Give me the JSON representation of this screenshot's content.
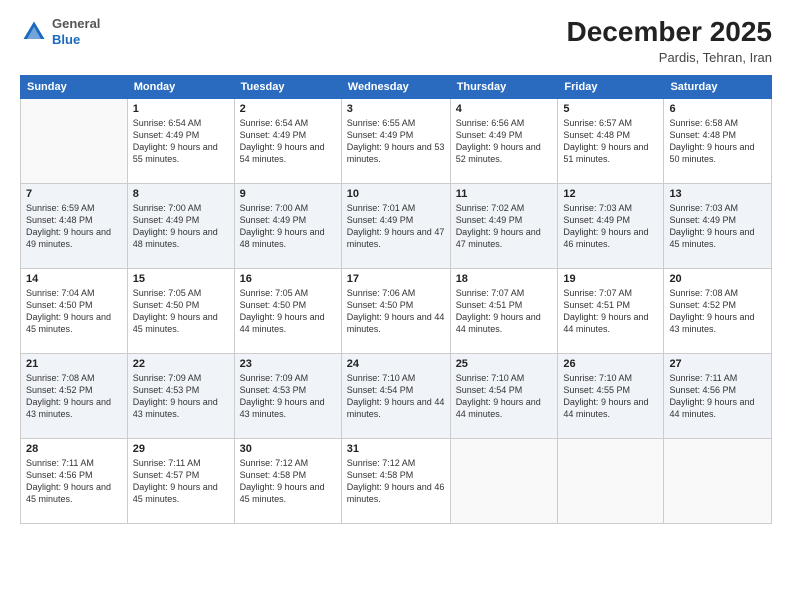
{
  "header": {
    "logo_general": "General",
    "logo_blue": "Blue",
    "month_title": "December 2025",
    "location": "Pardis, Tehran, Iran"
  },
  "columns": [
    "Sunday",
    "Monday",
    "Tuesday",
    "Wednesday",
    "Thursday",
    "Friday",
    "Saturday"
  ],
  "weeks": [
    {
      "shaded": false,
      "days": [
        {
          "num": "",
          "info": ""
        },
        {
          "num": "1",
          "info": "Sunrise: 6:54 AM\nSunset: 4:49 PM\nDaylight: 9 hours\nand 55 minutes."
        },
        {
          "num": "2",
          "info": "Sunrise: 6:54 AM\nSunset: 4:49 PM\nDaylight: 9 hours\nand 54 minutes."
        },
        {
          "num": "3",
          "info": "Sunrise: 6:55 AM\nSunset: 4:49 PM\nDaylight: 9 hours\nand 53 minutes."
        },
        {
          "num": "4",
          "info": "Sunrise: 6:56 AM\nSunset: 4:49 PM\nDaylight: 9 hours\nand 52 minutes."
        },
        {
          "num": "5",
          "info": "Sunrise: 6:57 AM\nSunset: 4:48 PM\nDaylight: 9 hours\nand 51 minutes."
        },
        {
          "num": "6",
          "info": "Sunrise: 6:58 AM\nSunset: 4:48 PM\nDaylight: 9 hours\nand 50 minutes."
        }
      ]
    },
    {
      "shaded": true,
      "days": [
        {
          "num": "7",
          "info": "Sunrise: 6:59 AM\nSunset: 4:48 PM\nDaylight: 9 hours\nand 49 minutes."
        },
        {
          "num": "8",
          "info": "Sunrise: 7:00 AM\nSunset: 4:49 PM\nDaylight: 9 hours\nand 48 minutes."
        },
        {
          "num": "9",
          "info": "Sunrise: 7:00 AM\nSunset: 4:49 PM\nDaylight: 9 hours\nand 48 minutes."
        },
        {
          "num": "10",
          "info": "Sunrise: 7:01 AM\nSunset: 4:49 PM\nDaylight: 9 hours\nand 47 minutes."
        },
        {
          "num": "11",
          "info": "Sunrise: 7:02 AM\nSunset: 4:49 PM\nDaylight: 9 hours\nand 47 minutes."
        },
        {
          "num": "12",
          "info": "Sunrise: 7:03 AM\nSunset: 4:49 PM\nDaylight: 9 hours\nand 46 minutes."
        },
        {
          "num": "13",
          "info": "Sunrise: 7:03 AM\nSunset: 4:49 PM\nDaylight: 9 hours\nand 45 minutes."
        }
      ]
    },
    {
      "shaded": false,
      "days": [
        {
          "num": "14",
          "info": "Sunrise: 7:04 AM\nSunset: 4:50 PM\nDaylight: 9 hours\nand 45 minutes."
        },
        {
          "num": "15",
          "info": "Sunrise: 7:05 AM\nSunset: 4:50 PM\nDaylight: 9 hours\nand 45 minutes."
        },
        {
          "num": "16",
          "info": "Sunrise: 7:05 AM\nSunset: 4:50 PM\nDaylight: 9 hours\nand 44 minutes."
        },
        {
          "num": "17",
          "info": "Sunrise: 7:06 AM\nSunset: 4:50 PM\nDaylight: 9 hours\nand 44 minutes."
        },
        {
          "num": "18",
          "info": "Sunrise: 7:07 AM\nSunset: 4:51 PM\nDaylight: 9 hours\nand 44 minutes."
        },
        {
          "num": "19",
          "info": "Sunrise: 7:07 AM\nSunset: 4:51 PM\nDaylight: 9 hours\nand 44 minutes."
        },
        {
          "num": "20",
          "info": "Sunrise: 7:08 AM\nSunset: 4:52 PM\nDaylight: 9 hours\nand 43 minutes."
        }
      ]
    },
    {
      "shaded": true,
      "days": [
        {
          "num": "21",
          "info": "Sunrise: 7:08 AM\nSunset: 4:52 PM\nDaylight: 9 hours\nand 43 minutes."
        },
        {
          "num": "22",
          "info": "Sunrise: 7:09 AM\nSunset: 4:53 PM\nDaylight: 9 hours\nand 43 minutes."
        },
        {
          "num": "23",
          "info": "Sunrise: 7:09 AM\nSunset: 4:53 PM\nDaylight: 9 hours\nand 43 minutes."
        },
        {
          "num": "24",
          "info": "Sunrise: 7:10 AM\nSunset: 4:54 PM\nDaylight: 9 hours\nand 44 minutes."
        },
        {
          "num": "25",
          "info": "Sunrise: 7:10 AM\nSunset: 4:54 PM\nDaylight: 9 hours\nand 44 minutes."
        },
        {
          "num": "26",
          "info": "Sunrise: 7:10 AM\nSunset: 4:55 PM\nDaylight: 9 hours\nand 44 minutes."
        },
        {
          "num": "27",
          "info": "Sunrise: 7:11 AM\nSunset: 4:56 PM\nDaylight: 9 hours\nand 44 minutes."
        }
      ]
    },
    {
      "shaded": false,
      "days": [
        {
          "num": "28",
          "info": "Sunrise: 7:11 AM\nSunset: 4:56 PM\nDaylight: 9 hours\nand 45 minutes."
        },
        {
          "num": "29",
          "info": "Sunrise: 7:11 AM\nSunset: 4:57 PM\nDaylight: 9 hours\nand 45 minutes."
        },
        {
          "num": "30",
          "info": "Sunrise: 7:12 AM\nSunset: 4:58 PM\nDaylight: 9 hours\nand 45 minutes."
        },
        {
          "num": "31",
          "info": "Sunrise: 7:12 AM\nSunset: 4:58 PM\nDaylight: 9 hours\nand 46 minutes."
        },
        {
          "num": "",
          "info": ""
        },
        {
          "num": "",
          "info": ""
        },
        {
          "num": "",
          "info": ""
        }
      ]
    }
  ]
}
